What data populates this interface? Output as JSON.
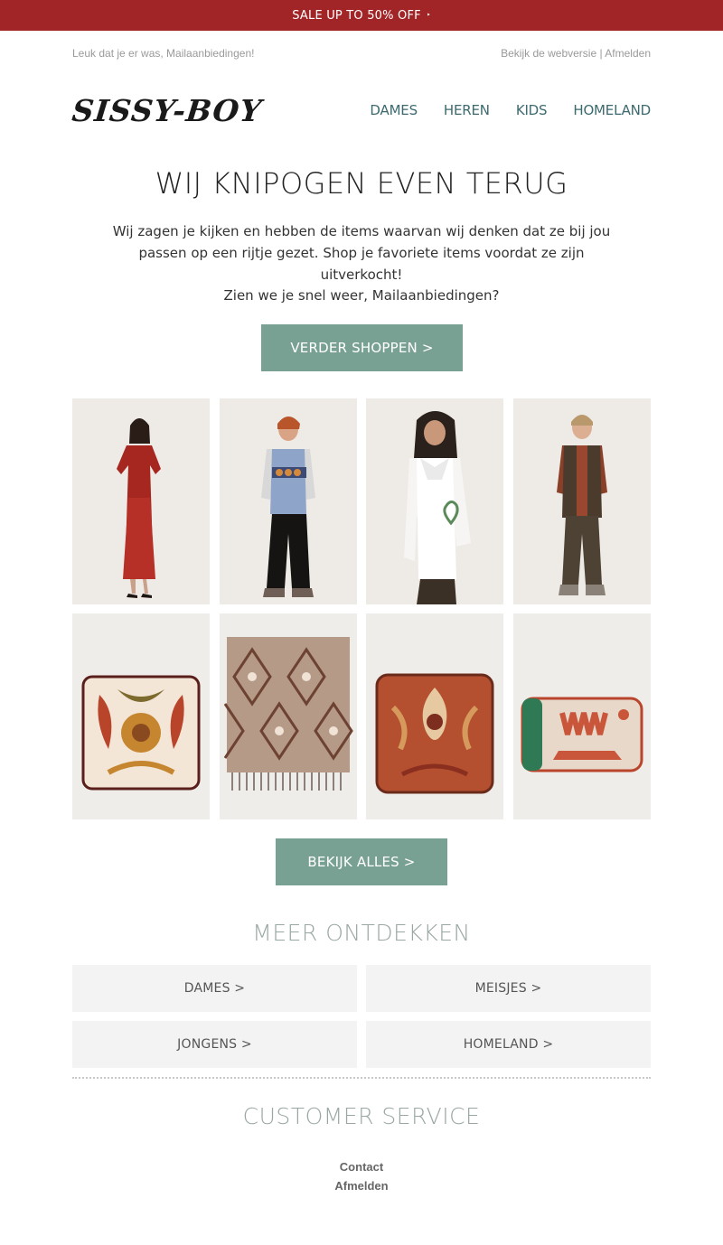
{
  "sale_bar": {
    "text": "SALE UP TO 50% OFF",
    "arrow": "‣"
  },
  "preheader": {
    "greeting": "Leuk dat je er was, Mailaanbiedingen!",
    "webversion": "Bekijk de webversie",
    "separator": "|",
    "unsubscribe": "Afmelden"
  },
  "header": {
    "logo": "SISSY-BOY",
    "nav": [
      "DAMES",
      "HEREN",
      "KIDS",
      "HOMELAND"
    ]
  },
  "main": {
    "headline": "WIJ KNIPOGEN EVEN TERUG",
    "intro": "Wij zagen je kijken en hebben de items waarvan wij denken dat ze bij jou passen op een rijtje gezet. Shop je favoriete items voordat ze zijn uitverkocht!",
    "greeting": "Zien we je snel weer, Mailaanbiedingen?",
    "shop_button": "VERDER SHOPPEN >",
    "view_all_button": "BEKIJK ALLES >"
  },
  "products": [
    {
      "kind": "red-dress-woman"
    },
    {
      "kind": "boy-sweater-vest"
    },
    {
      "kind": "girl-white-blouse"
    },
    {
      "kind": "boy-brown-gilet"
    },
    {
      "kind": "floral-cushion"
    },
    {
      "kind": "patterned-throw"
    },
    {
      "kind": "rust-cushion"
    },
    {
      "kind": "lumbar-cushion"
    }
  ],
  "discover": {
    "title": "MEER ONTDEKKEN",
    "categories": [
      "DAMES >",
      "MEISJES >",
      "JONGENS >",
      "HOMELAND >"
    ]
  },
  "customer_service": {
    "title": "CUSTOMER SERVICE",
    "links": [
      "Contact",
      "Afmelden"
    ]
  },
  "colors": {
    "sale_bar": "#a12527",
    "button": "#79a193",
    "nav": "#3c6a6f",
    "section_title": "#9aa8a5"
  }
}
